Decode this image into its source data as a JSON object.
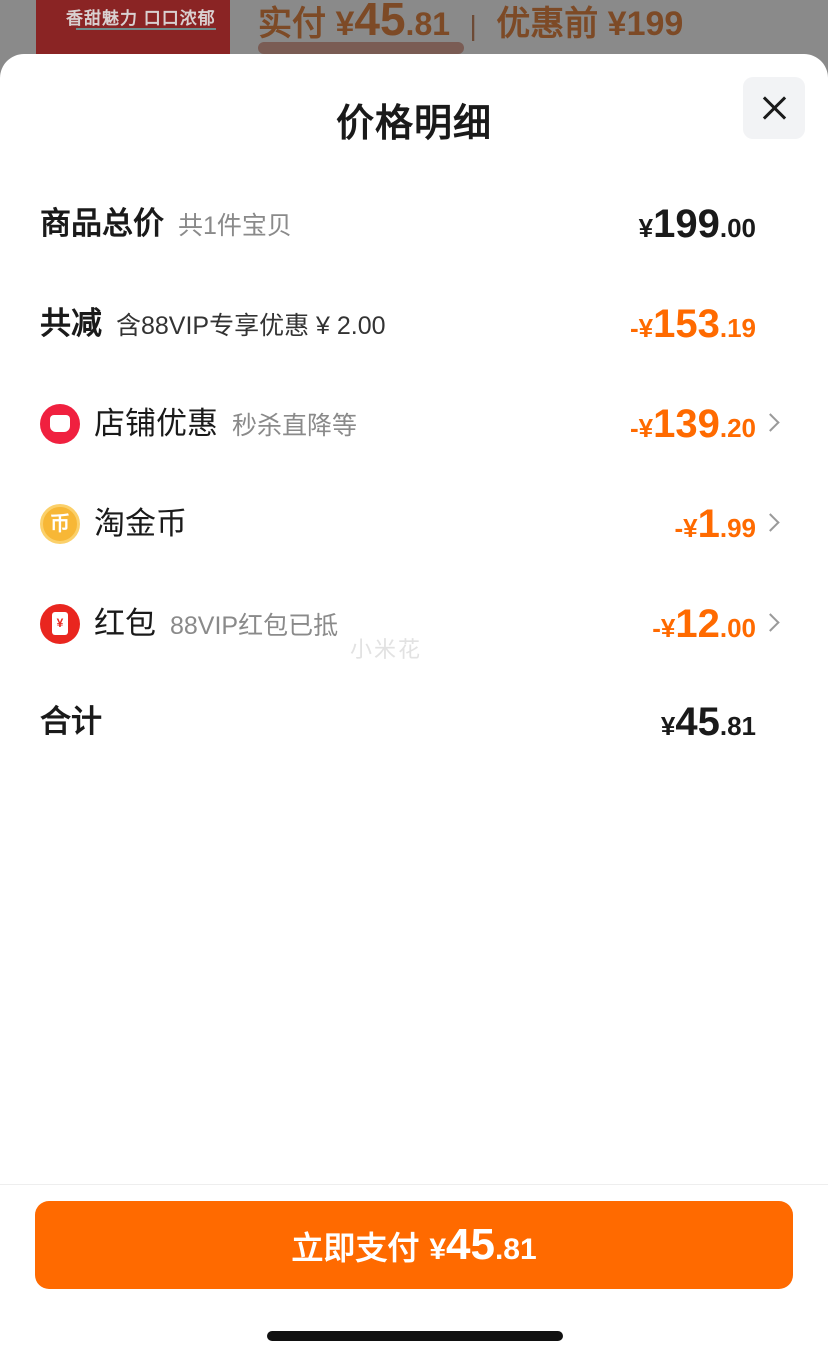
{
  "background": {
    "thumb_text": "香甜魅力 口口浓郁",
    "price_prefix": "实付",
    "price_currency": "¥",
    "price_int": "45",
    "price_dec": ".81",
    "separator": "|",
    "original_price": "优惠前 ¥199"
  },
  "sheet": {
    "title": "价格明细",
    "watermark": "小米花"
  },
  "rows": {
    "subtotal": {
      "label": "商品总价",
      "sub": "共1件宝贝",
      "cur": "¥",
      "int": "199",
      "dec": ".00"
    },
    "total_discount": {
      "label": "共减",
      "sub": "含88VIP专享优惠 ¥ 2.00",
      "cur": "-¥",
      "int": "153",
      "dec": ".19"
    },
    "shop_discount": {
      "label": "店铺优惠",
      "sub": "秒杀直降等",
      "cur": "-¥",
      "int": "139",
      "dec": ".20"
    },
    "coins": {
      "label": "淘金币",
      "icon_text": "币",
      "cur": "-¥",
      "int": "1",
      "dec": ".99"
    },
    "red_packet": {
      "label": "红包",
      "sub": "88VIP红包已抵",
      "cur": "-¥",
      "int": "12",
      "dec": ".00"
    },
    "total": {
      "label": "合计",
      "cur": "¥",
      "int": "45",
      "dec": ".81"
    }
  },
  "pay_button": {
    "label": "立即支付",
    "cur": "¥",
    "int": "45",
    "dec": ".81"
  },
  "colors": {
    "accent": "#ff6a00",
    "text": "#1a1a1a",
    "muted": "#8a8a8a"
  }
}
